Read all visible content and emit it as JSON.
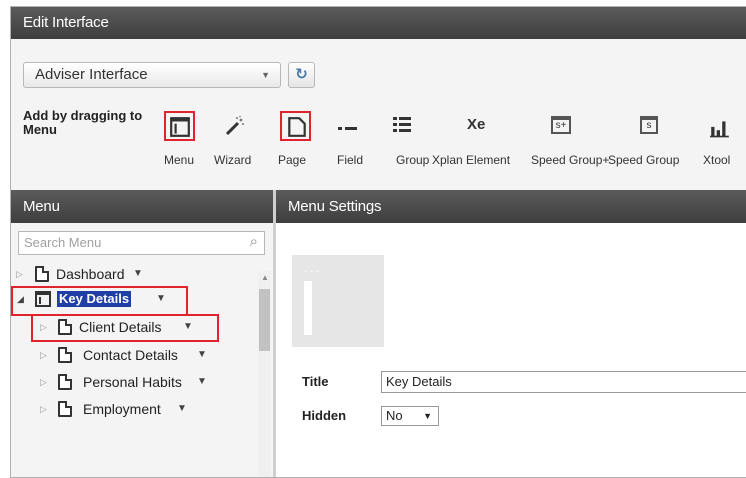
{
  "window": {
    "title": "Edit Interface"
  },
  "toolbar": {
    "interface_select": "Adviser Interface",
    "add_label": "Add by dragging to Menu",
    "tools": [
      {
        "label": "Menu",
        "icon": "menu-window-icon"
      },
      {
        "label": "Wizard",
        "icon": "wizard-wand-icon"
      },
      {
        "label": "Page",
        "icon": "page-icon"
      },
      {
        "label": "Field",
        "icon": "field-icon"
      },
      {
        "label": "Group",
        "icon": "group-list-icon"
      },
      {
        "label": "Xplan Element",
        "icon": "xe-icon",
        "glyph": "Xe"
      },
      {
        "label": "Speed Group+",
        "icon": "speed-group-plus-icon",
        "glyph": "s+"
      },
      {
        "label": "Speed Group",
        "icon": "speed-group-icon",
        "glyph": "s"
      },
      {
        "label": "Xtool",
        "icon": "bar-chart-icon"
      }
    ]
  },
  "menu_pane": {
    "title": "Menu",
    "search_placeholder": "Search Menu",
    "items": [
      {
        "label": "Dashboard"
      },
      {
        "label": "Key Details"
      },
      {
        "label": "Client Details"
      },
      {
        "label": "Contact Details"
      },
      {
        "label": "Personal Habits"
      },
      {
        "label": "Employment"
      }
    ]
  },
  "settings_pane": {
    "title": "Menu Settings",
    "title_label": "Title",
    "title_value": "Key Details",
    "hidden_label": "Hidden",
    "hidden_value": "No"
  },
  "colors": {
    "header": "#4a4a4a",
    "highlight": "#e0232d",
    "selection": "#1f3fa6"
  }
}
